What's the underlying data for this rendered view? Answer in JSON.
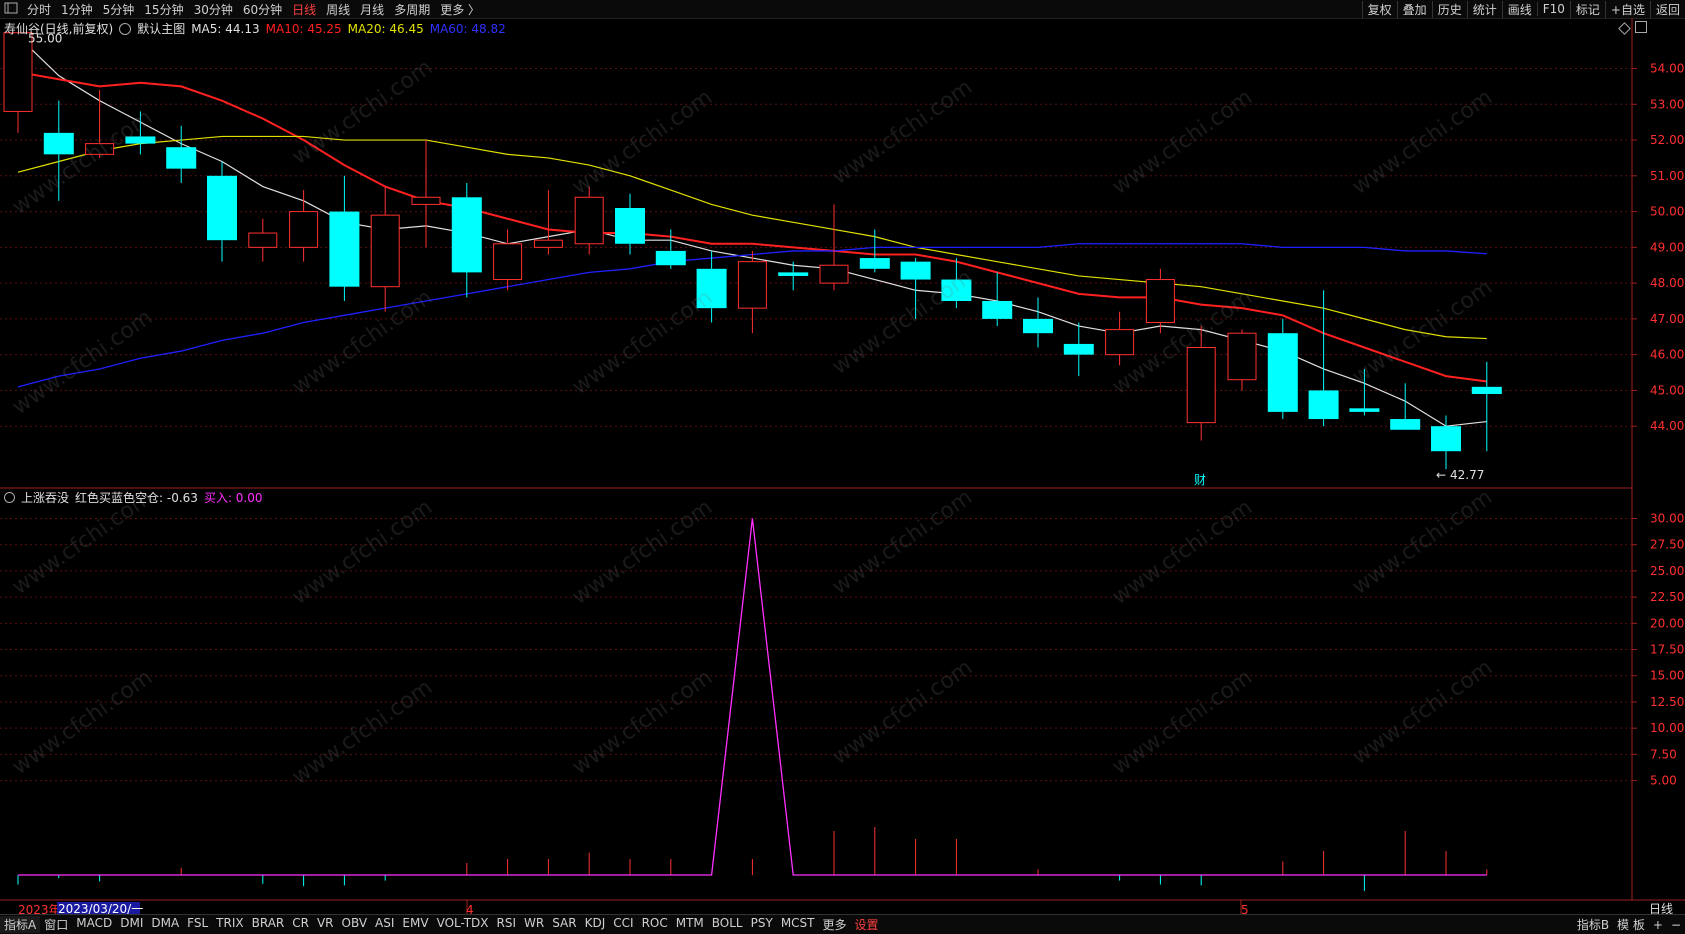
{
  "topbar": {
    "app_icon": "menu-icon",
    "periods": [
      "分时",
      "1分钟",
      "5分钟",
      "15分钟",
      "30分钟",
      "60分钟",
      "日线",
      "周线",
      "月线",
      "多周期",
      "更多 〉"
    ],
    "active_period": "日线",
    "right_items": [
      "复权",
      "叠加",
      "历史",
      "统计",
      "画线",
      "F10",
      "标记",
      "+自选",
      "返回"
    ]
  },
  "main_legend": {
    "stock": "寿仙谷(日线,前复权)",
    "template": "默认主图",
    "ma5": "MA5: 44.13",
    "ma10": "MA10: 45.25",
    "ma20": "MA20: 46.45",
    "ma60": "MA60: 48.82",
    "colors": {
      "ma5": "#e0e0e0",
      "ma10": "#ff2020",
      "ma20": "#e0e000",
      "ma60": "#2020ff",
      "up": "#ff3030",
      "down": "#00ffff"
    }
  },
  "sub_legend": {
    "name": "上涨吞没",
    "line1": "红色买蓝色空仓: -0.63",
    "line2": "买入: 0.00",
    "colors": {
      "line2": "#ff30ff"
    }
  },
  "annotations": {
    "high_label": "55.00",
    "low_label": "42.77",
    "event_marker": "财"
  },
  "x_axis": {
    "start_year": "2023年",
    "cursor_date": "2023/03/20/一",
    "month_4": "4",
    "month_5": "5",
    "period_label": "日线"
  },
  "chart_data": [
    {
      "type": "candlestick",
      "title": "寿仙谷(日线,前复权)",
      "y_ticks": [
        "54.00",
        "53.00",
        "52.00",
        "51.00",
        "50.00",
        "49.00",
        "48.00",
        "47.00",
        "46.00",
        "45.00",
        "44.00"
      ],
      "ylim": [
        42.3,
        55.3
      ],
      "candles": [
        {
          "o": 52.8,
          "h": 55.0,
          "l": 52.2,
          "c": 55.0
        },
        {
          "o": 52.2,
          "h": 53.1,
          "l": 50.3,
          "c": 51.6
        },
        {
          "o": 51.6,
          "h": 53.4,
          "l": 51.5,
          "c": 51.9
        },
        {
          "o": 52.1,
          "h": 52.8,
          "l": 51.6,
          "c": 51.9
        },
        {
          "o": 51.8,
          "h": 52.4,
          "l": 50.8,
          "c": 51.2
        },
        {
          "o": 51.0,
          "h": 51.4,
          "l": 48.6,
          "c": 49.2
        },
        {
          "o": 49.0,
          "h": 49.8,
          "l": 48.6,
          "c": 49.4
        },
        {
          "o": 49.0,
          "h": 50.6,
          "l": 48.6,
          "c": 50.0
        },
        {
          "o": 50.0,
          "h": 51.0,
          "l": 47.5,
          "c": 47.9
        },
        {
          "o": 47.9,
          "h": 50.7,
          "l": 47.2,
          "c": 49.9
        },
        {
          "o": 50.2,
          "h": 52.0,
          "l": 49.0,
          "c": 50.4
        },
        {
          "o": 50.4,
          "h": 50.8,
          "l": 47.6,
          "c": 48.3
        },
        {
          "o": 48.1,
          "h": 49.5,
          "l": 47.8,
          "c": 49.1
        },
        {
          "o": 49.0,
          "h": 50.6,
          "l": 48.8,
          "c": 49.2
        },
        {
          "o": 49.1,
          "h": 50.7,
          "l": 48.8,
          "c": 50.4
        },
        {
          "o": 50.1,
          "h": 50.5,
          "l": 48.8,
          "c": 49.1
        },
        {
          "o": 48.9,
          "h": 49.5,
          "l": 48.4,
          "c": 48.5
        },
        {
          "o": 48.4,
          "h": 48.9,
          "l": 46.9,
          "c": 47.3
        },
        {
          "o": 47.3,
          "h": 48.9,
          "l": 46.6,
          "c": 48.6
        },
        {
          "o": 48.3,
          "h": 48.6,
          "l": 47.8,
          "c": 48.2
        },
        {
          "o": 48.0,
          "h": 50.2,
          "l": 47.8,
          "c": 48.5
        },
        {
          "o": 48.7,
          "h": 49.5,
          "l": 48.3,
          "c": 48.4
        },
        {
          "o": 48.6,
          "h": 48.7,
          "l": 47.0,
          "c": 48.1
        },
        {
          "o": 48.1,
          "h": 48.7,
          "l": 47.3,
          "c": 47.5
        },
        {
          "o": 47.5,
          "h": 48.3,
          "l": 46.8,
          "c": 47.0
        },
        {
          "o": 47.0,
          "h": 47.6,
          "l": 46.2,
          "c": 46.6
        },
        {
          "o": 46.3,
          "h": 46.9,
          "l": 45.4,
          "c": 46.0
        },
        {
          "o": 46.0,
          "h": 47.2,
          "l": 45.7,
          "c": 46.7
        },
        {
          "o": 46.9,
          "h": 48.4,
          "l": 46.6,
          "c": 48.1
        },
        {
          "o": 44.1,
          "h": 46.8,
          "l": 43.6,
          "c": 46.2
        },
        {
          "o": 45.3,
          "h": 46.7,
          "l": 45.0,
          "c": 46.6
        },
        {
          "o": 46.6,
          "h": 47.0,
          "l": 44.2,
          "c": 44.4
        },
        {
          "o": 45.0,
          "h": 47.8,
          "l": 44.0,
          "c": 44.2
        },
        {
          "o": 44.5,
          "h": 45.6,
          "l": 44.3,
          "c": 44.4
        },
        {
          "o": 44.2,
          "h": 45.2,
          "l": 44.0,
          "c": 43.9
        },
        {
          "o": 44.0,
          "h": 44.3,
          "l": 42.8,
          "c": 43.3
        },
        {
          "o": 45.1,
          "h": 45.8,
          "l": 43.3,
          "c": 44.9
        }
      ],
      "series": [
        {
          "name": "MA5",
          "values": [
            54.9,
            53.8,
            53.1,
            52.5,
            51.9,
            51.4,
            50.7,
            50.3,
            49.7,
            49.5,
            49.6,
            49.4,
            49.1,
            49.3,
            49.5,
            49.2,
            49.2,
            48.9,
            48.7,
            48.5,
            48.4,
            48.1,
            47.8,
            47.7,
            47.5,
            47.2,
            46.8,
            46.6,
            46.8,
            46.7,
            46.4,
            46.1,
            45.6,
            45.2,
            44.7,
            44.0,
            44.13
          ]
        },
        {
          "name": "MA10",
          "values": [
            53.9,
            53.7,
            53.5,
            53.6,
            53.5,
            53.1,
            52.6,
            52.0,
            51.3,
            50.7,
            50.3,
            50.1,
            49.8,
            49.5,
            49.4,
            49.4,
            49.3,
            49.1,
            49.1,
            49.0,
            48.9,
            48.8,
            48.8,
            48.6,
            48.3,
            48.0,
            47.7,
            47.6,
            47.6,
            47.4,
            47.3,
            47.1,
            46.6,
            46.2,
            45.8,
            45.4,
            45.25
          ]
        },
        {
          "name": "MA20",
          "values": [
            51.1,
            51.4,
            51.7,
            51.9,
            52.0,
            52.1,
            52.1,
            52.1,
            52.0,
            52.0,
            52.0,
            51.8,
            51.6,
            51.5,
            51.3,
            51.0,
            50.6,
            50.2,
            49.9,
            49.7,
            49.5,
            49.3,
            49.0,
            48.8,
            48.6,
            48.4,
            48.2,
            48.1,
            48.0,
            47.9,
            47.7,
            47.5,
            47.3,
            47.0,
            46.7,
            46.5,
            46.45
          ]
        },
        {
          "name": "MA60",
          "values": [
            45.1,
            45.4,
            45.6,
            45.9,
            46.1,
            46.4,
            46.6,
            46.9,
            47.1,
            47.3,
            47.5,
            47.7,
            47.9,
            48.1,
            48.3,
            48.4,
            48.6,
            48.7,
            48.8,
            48.9,
            48.9,
            49.0,
            49.0,
            49.0,
            49.0,
            49.0,
            49.1,
            49.1,
            49.1,
            49.1,
            49.1,
            49.0,
            49.0,
            49.0,
            48.9,
            48.9,
            48.82
          ]
        }
      ]
    },
    {
      "type": "line",
      "title": "上涨吞没",
      "y_ticks": [
        "30.00",
        "27.50",
        "25.00",
        "22.50",
        "20.00",
        "17.50",
        "15.00",
        "12.50",
        "10.00",
        "7.50",
        "5.00"
      ],
      "ylim": [
        0,
        31
      ],
      "series": [
        {
          "name": "买入",
          "values": [
            0,
            0,
            0,
            0,
            0,
            0,
            0,
            0,
            0,
            0,
            0,
            0,
            0,
            0,
            0,
            0,
            0,
            0,
            30,
            0,
            0,
            0,
            0,
            0,
            0,
            0,
            0,
            0,
            0,
            0,
            0,
            0,
            0,
            0,
            0,
            0,
            0
          ]
        }
      ],
      "bars": [
        -1.2,
        -0.4,
        -0.8,
        0,
        0.9,
        0,
        -1.1,
        -1.4,
        -1.3,
        -0.7,
        0,
        1.5,
        2.0,
        2.0,
        2.8,
        2.0,
        2.0,
        0,
        2.0,
        0,
        5.5,
        6.0,
        4.5,
        4.5,
        0,
        0.7,
        0,
        -0.7,
        -1.2,
        -1.3,
        0,
        1.7,
        3.0,
        -2.0,
        5.5,
        3.0,
        0.7
      ]
    }
  ]
}
